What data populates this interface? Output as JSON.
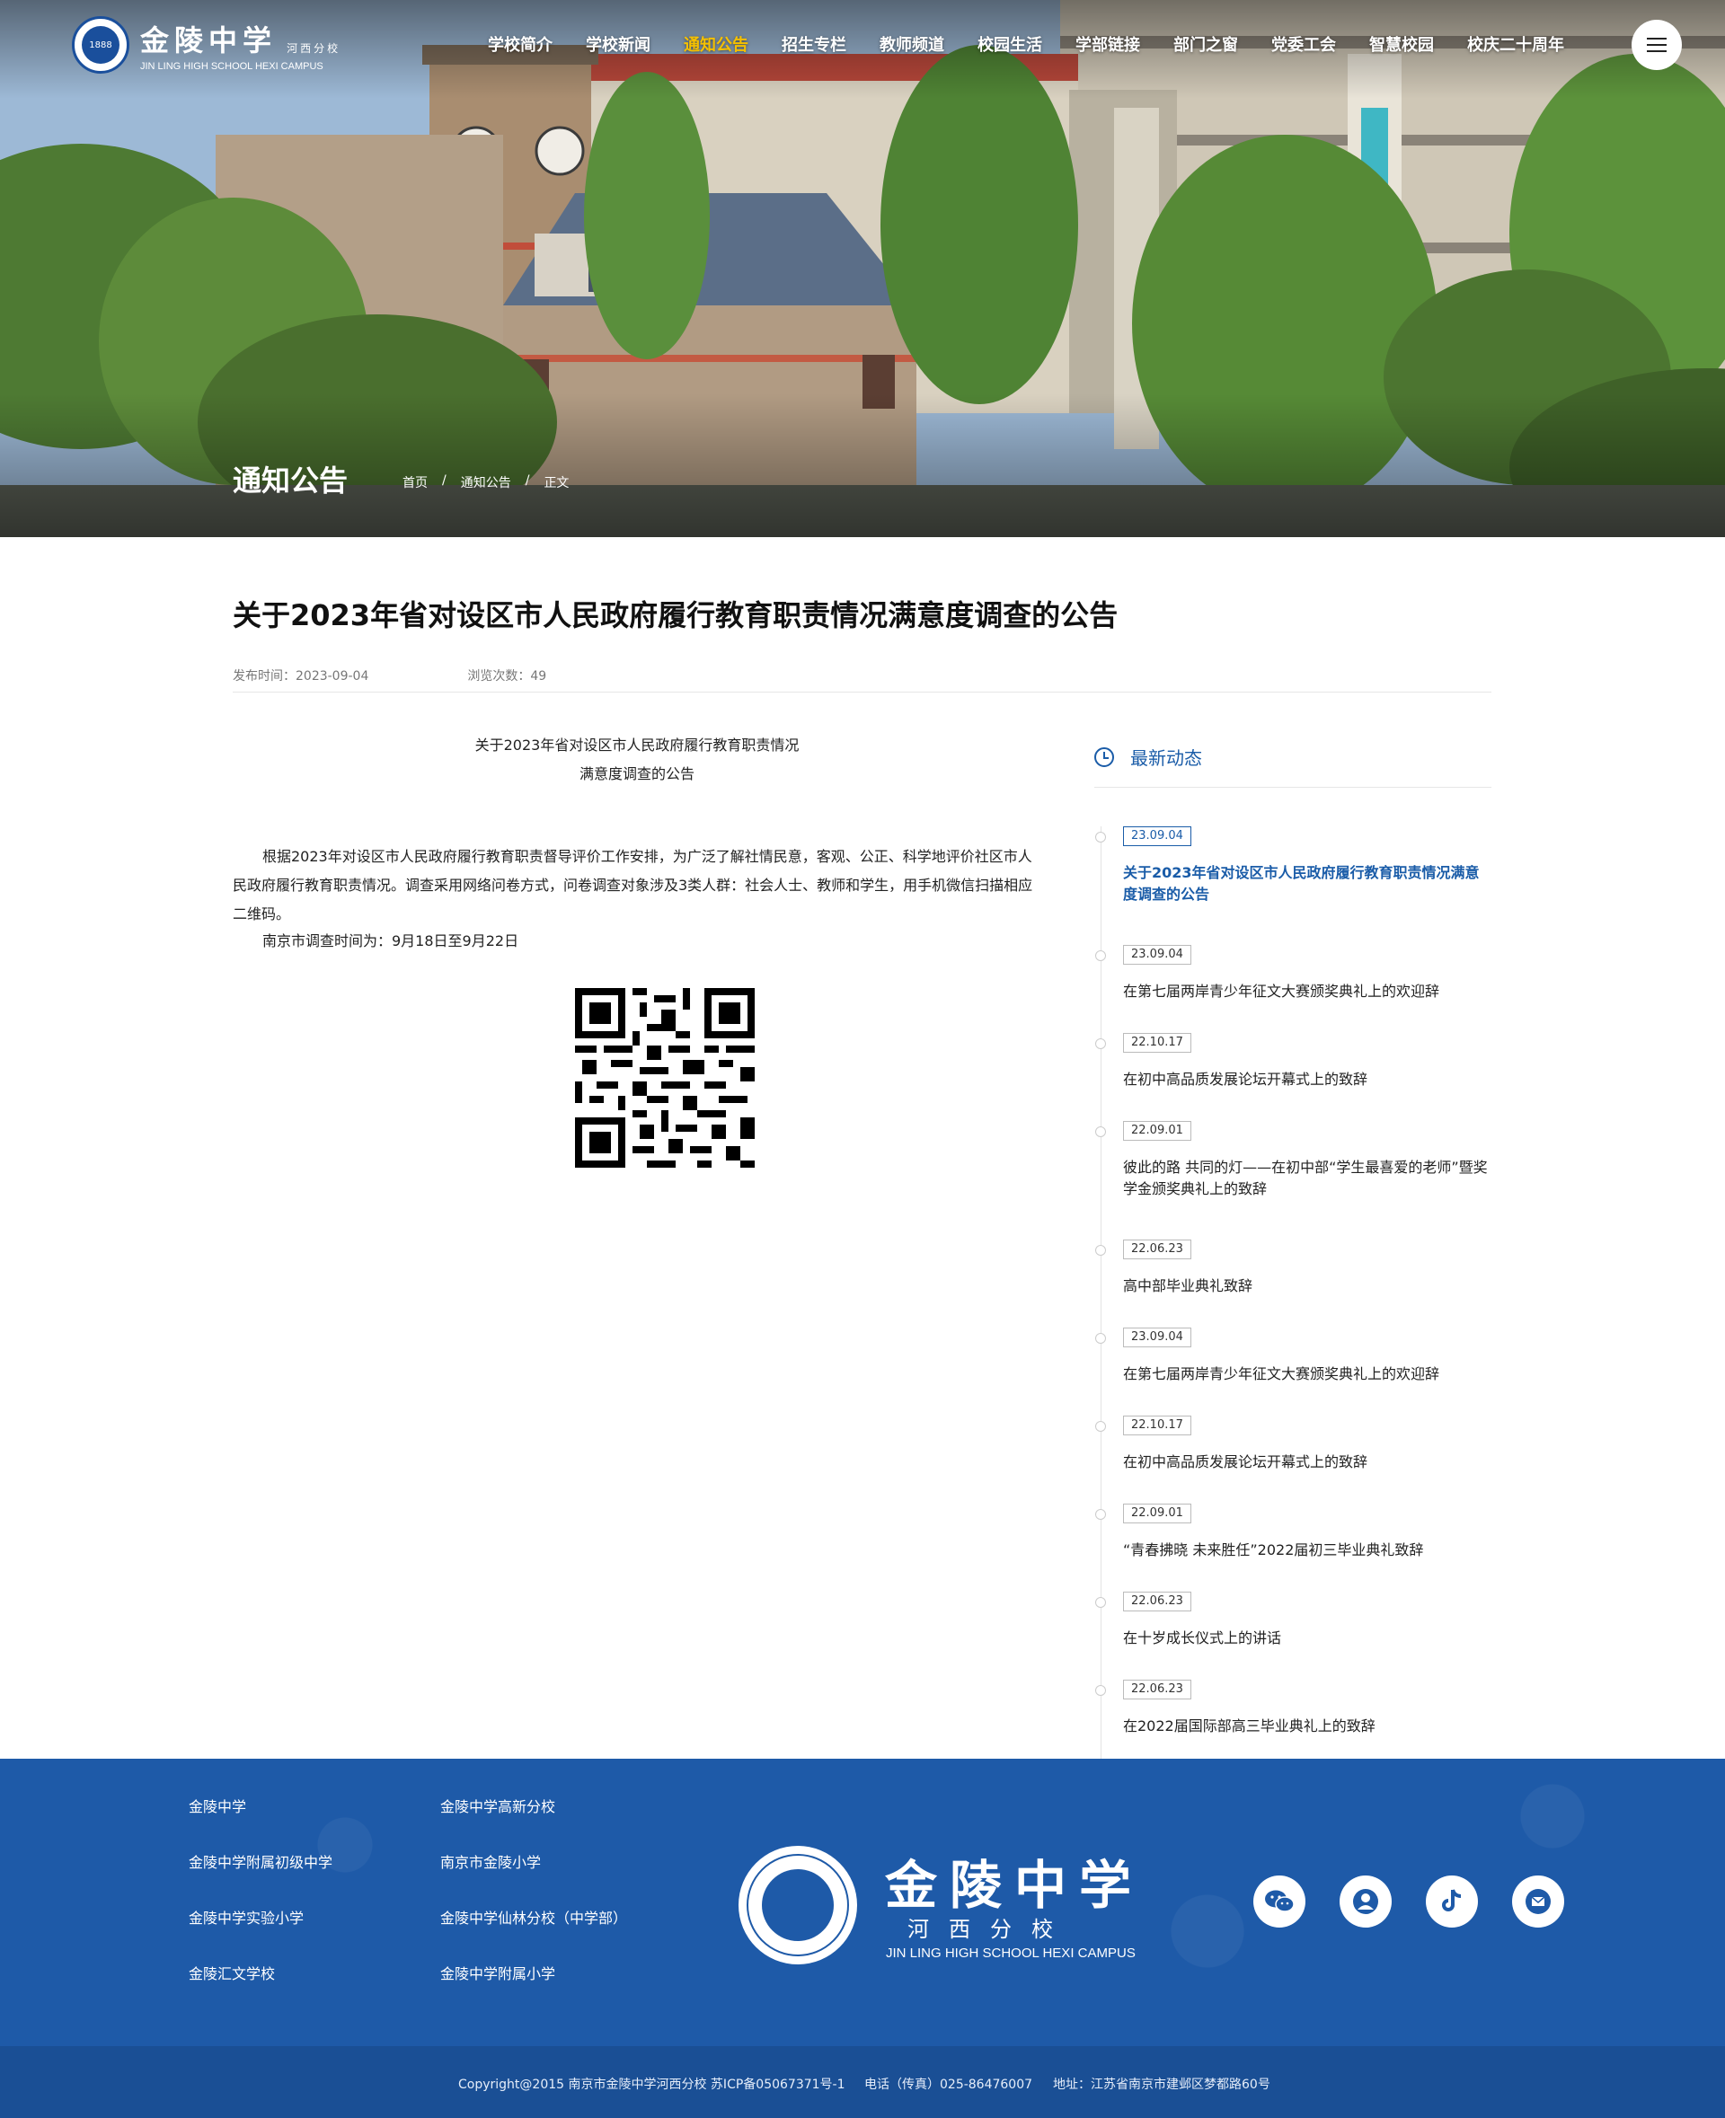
{
  "header": {
    "logo_cn": "金陵中学",
    "logo_sub": "河西分校",
    "logo_en": "JIN LING HIGH SCHOOL HEXI CAMPUS",
    "nav": [
      "学校简介",
      "学校新闻",
      "通知公告",
      "招生专栏",
      "教师频道",
      "校园生活",
      "学部链接",
      "部门之窗",
      "党委工会",
      "智慧校园",
      "校庆二十周年"
    ],
    "active_nav": "通知公告"
  },
  "banner": {
    "title": "通知公告",
    "breadcrumb": [
      "首页",
      "通知公告",
      "正文"
    ],
    "separator": "/"
  },
  "article": {
    "title": "关于2023年省对设区市人民政府履行教育职责情况满意度调查的公告",
    "publish_time": "发布时间：2023-09-04",
    "views": "浏览次数：49",
    "heading_line1": "关于2023年省对设区市人民政府履行教育职责情况",
    "heading_line2": "满意度调查的公告",
    "paragraph": "根据2023年对设区市人民政府履行教育职责督导评价工作安排，为广泛了解社情民意，客观、公正、科学地评价社区市人民政府履行教育职责情况。调查采用网络问卷方式，问卷调查对象涉及3类人群：社会人士、教师和学生，用手机微信扫描相应二维码。",
    "survey_time": "南京市调查时间为：9月18日至9月22日"
  },
  "sidebar": {
    "heading": "最新动态",
    "items": [
      {
        "date": "23.09.04",
        "title": "关于2023年省对设区市人民政府履行教育职责情况满意度调查的公告"
      },
      {
        "date": "23.09.04",
        "title": "在第七届两岸青少年征文大赛颁奖典礼上的欢迎辞"
      },
      {
        "date": "22.10.17",
        "title": "在初中高品质发展论坛开幕式上的致辞"
      },
      {
        "date": "22.09.01",
        "title": "彼此的路 共同的灯——在初中部“学生最喜爱的老师”暨奖学金颁奖典礼上的致辞"
      },
      {
        "date": "22.06.23",
        "title": "高中部毕业典礼致辞"
      },
      {
        "date": "23.09.04",
        "title": "在第七届两岸青少年征文大赛颁奖典礼上的欢迎辞"
      },
      {
        "date": "22.10.17",
        "title": "在初中高品质发展论坛开幕式上的致辞"
      },
      {
        "date": "22.09.01",
        "title": "“青春拂晓 未来胜任”2022届初三毕业典礼致辞"
      },
      {
        "date": "22.06.23",
        "title": "在十岁成长仪式上的讲话"
      },
      {
        "date": "22.06.23",
        "title": "在2022届国际部高三毕业典礼上的致辞"
      }
    ]
  },
  "footer": {
    "links_col1": [
      "金陵中学",
      "金陵中学附属初级中学",
      "金陵中学实验小学",
      "金陵汇文学校"
    ],
    "links_col2": [
      "金陵中学高新分校",
      "南京市金陵小学",
      "金陵中学仙林分校（中学部）",
      "金陵中学附属小学"
    ],
    "logo_cn": "金陵中学",
    "logo_sub": "河西分校",
    "logo_en": "JIN LING HIGH SCHOOL HEXI CAMPUS",
    "social_icons": [
      "wechat-icon",
      "user-icon",
      "douyin-icon",
      "mail-icon"
    ],
    "copyright": "Copyright@2015 南京市金陵中学河西分校  苏ICP备05067371号-1",
    "phone": "电话（传真）025-86476007",
    "address": "地址：江苏省南京市建邺区梦都路60号"
  },
  "colors": {
    "accent": "#1a5ca8",
    "footer_bg": "#1e5aa8",
    "nav_active": "#f5c000"
  }
}
